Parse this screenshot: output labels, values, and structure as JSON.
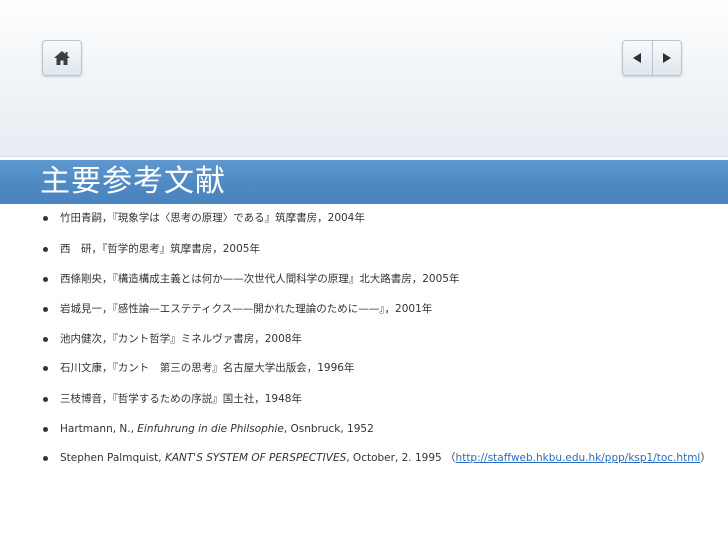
{
  "slide": {
    "title": "主要参考文献",
    "nav": {
      "home_icon": "home-icon",
      "prev_icon": "triangle-left-icon",
      "next_icon": "triangle-right-icon"
    },
    "references": [
      {
        "text": "竹田青嗣，『現象学は〈思考の原理〉である』筑摩書房，2004年"
      },
      {
        "text": "西　研，『哲学的思考』筑摩書房，2005年"
      },
      {
        "text": "西條剛央，『構造構成主義とは何か——次世代人間科学の原理』北大路書房，2005年"
      },
      {
        "text": "岩城見一，『感性論—エステティクス——開かれた理論のために——』，2001年"
      },
      {
        "text": "池内健次，『カント哲学』ミネルヴァ書房，2008年"
      },
      {
        "text": "石川文康，『カント　第三の思考』名古屋大学出版会，1996年"
      },
      {
        "text": "三枝博音，『哲学するための序説』国土社，1948年"
      },
      {
        "pre": "Hartmann, N., ",
        "italic": "Einfuhrung in die Philsophie",
        "post": ", Osnbruck, 1952"
      },
      {
        "pre": "Stephen Palmquist,  ",
        "italic": "KANT'S SYSTEM OF PERSPECTIVES",
        "post": ",  October, 2. 1995 （",
        "link": "http://staffweb.hkbu.edu.hk/ppp/ksp1/toc.html",
        "tail": "）"
      }
    ]
  },
  "colors": {
    "title_band": "#4e89c3",
    "title_text": "#ffffff",
    "body_text": "#333333",
    "link": "#2a6cc0"
  }
}
